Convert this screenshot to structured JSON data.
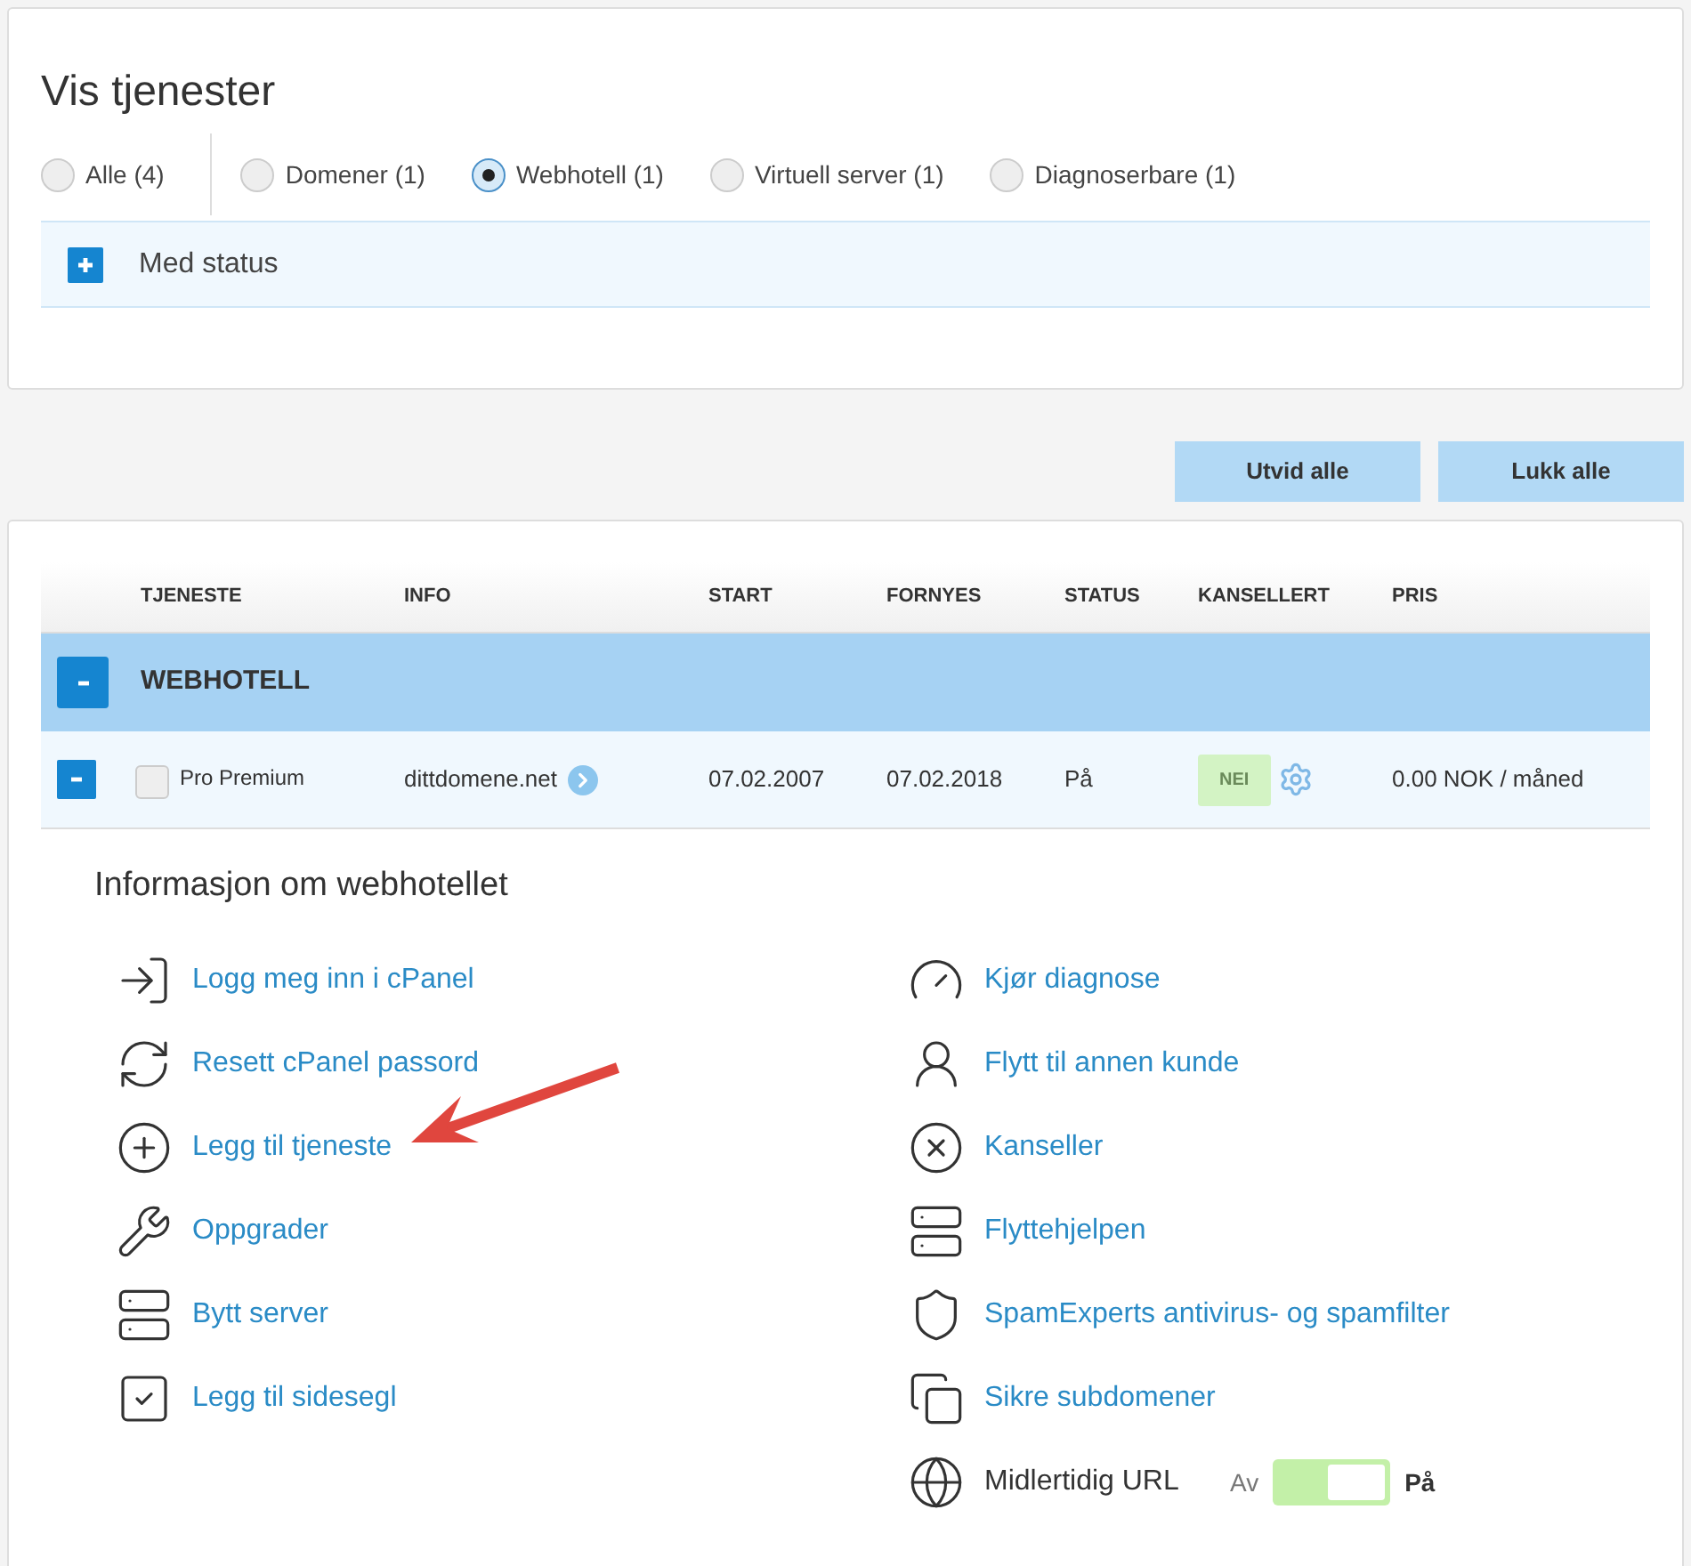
{
  "filter": {
    "title": "Vis tjenester",
    "options": [
      {
        "label": "Alle (4)",
        "selected": false
      },
      {
        "label": "Domener (1)",
        "selected": false
      },
      {
        "label": "Webhotell (1)",
        "selected": true
      },
      {
        "label": "Virtuell server (1)",
        "selected": false
      },
      {
        "label": "Diagnoserbare (1)",
        "selected": false
      }
    ],
    "status_section": {
      "label": "Med status",
      "expanded": false
    }
  },
  "buttons": [
    "Utvid alle",
    "Lukk alle"
  ],
  "table": {
    "columns": [
      "TJENESTE",
      "INFO",
      "START",
      "FORNYES",
      "STATUS",
      "KANSELLERT",
      "PRIS"
    ],
    "groups": [
      {
        "name": "WEBHOTELL",
        "expanded": true,
        "rows": [
          {
            "service": "Pro Premium",
            "checked": false,
            "expanded": true,
            "info": "dittdomene.net",
            "start": "07.02.2007",
            "renew": "07.02.2018",
            "status": "På",
            "cancelled": "NEI",
            "price": "0.00 NOK / måned"
          }
        ]
      }
    ]
  },
  "info_panel": {
    "title": "Informasjon om webhotellet",
    "left": [
      {
        "kind": "link",
        "label": "Logg meg inn i cPanel"
      },
      {
        "kind": "link",
        "label": "Resett cPanel passord"
      },
      {
        "kind": "link",
        "label": "Legg til tjeneste"
      },
      {
        "kind": "link",
        "label": "Oppgrader"
      },
      {
        "kind": "link",
        "label": "Bytt server"
      },
      {
        "kind": "link",
        "label": "Legg til sidesegl"
      }
    ],
    "right": [
      {
        "kind": "link",
        "label": "Kjør diagnose"
      },
      {
        "kind": "link",
        "label": "Flytt til annen kunde"
      },
      {
        "kind": "link",
        "label": "Kanseller"
      },
      {
        "kind": "link",
        "label": "Flyttehjelpen"
      },
      {
        "kind": "link",
        "label": "SpamExperts antivirus- og spamfilter"
      },
      {
        "kind": "link",
        "label": "Sikre subdomener"
      },
      {
        "kind": "toggle",
        "label": "Midlertidig URL",
        "off_label": "Av",
        "on_label": "På",
        "on": true
      }
    ]
  }
}
